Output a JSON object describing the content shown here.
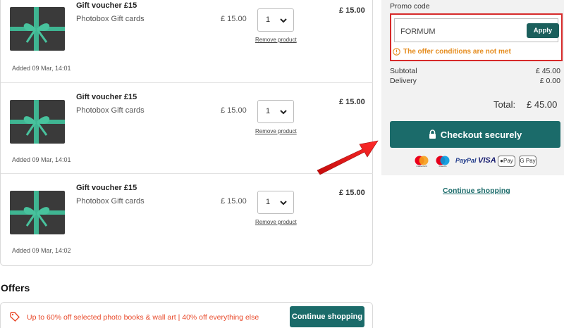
{
  "cart_items": [
    {
      "title": "Gift voucher £15",
      "subtitle": "Photobox Gift cards",
      "unit_price": "£ 15.00",
      "quantity": "1",
      "remove_label": "Remove product",
      "line_total": "£ 15.00",
      "added": "Added 09 Mar, 14:01"
    },
    {
      "title": "Gift voucher £15",
      "subtitle": "Photobox Gift cards",
      "unit_price": "£ 15.00",
      "quantity": "1",
      "remove_label": "Remove product",
      "line_total": "£ 15.00",
      "added": "Added 09 Mar, 14:01"
    },
    {
      "title": "Gift voucher £15",
      "subtitle": "Photobox Gift cards",
      "unit_price": "£ 15.00",
      "quantity": "1",
      "remove_label": "Remove product",
      "line_total": "£ 15.00",
      "added": "Added 09 Mar, 14:02"
    }
  ],
  "offers": {
    "title": "Offers",
    "text": "Up to 60% off selected photo books & wall art | 40% off everything else",
    "button": "Continue shopping"
  },
  "summary": {
    "promo_label": "Promo code",
    "promo_value": "FORMUM",
    "apply_label": "Apply",
    "promo_error": "The offer conditions are not met",
    "subtotal_label": "Subtotal",
    "subtotal_value": "£ 45.00",
    "delivery_label": "Delivery",
    "delivery_value": "£ 0.00",
    "total_label": "Total:",
    "total_value": "£ 45.00",
    "checkout_label": "Checkout securely",
    "payment_methods": [
      "mastercard",
      "maestro",
      "PayPal",
      "VISA",
      "Pay",
      "G Pay"
    ],
    "continue_label": "Continue shopping"
  },
  "colors": {
    "primary": "#1b6b6a",
    "error_text": "#e58c1e",
    "offer_text": "#e8492a",
    "highlight": "#d62a2a"
  }
}
